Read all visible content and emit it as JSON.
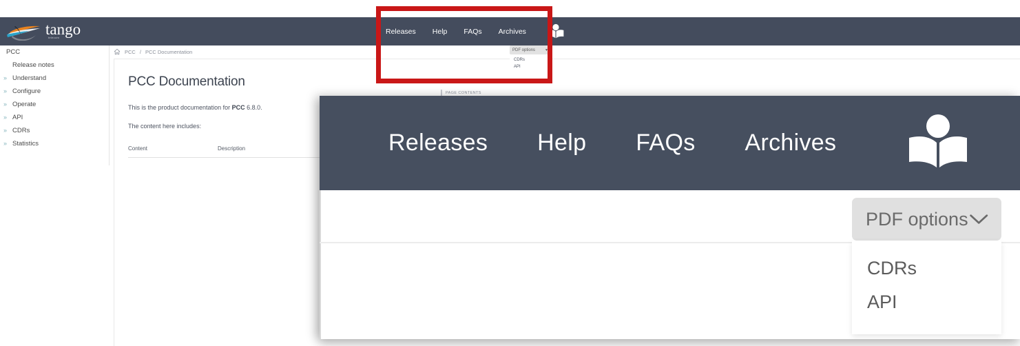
{
  "site": {
    "logo_text": "tango",
    "logo_subtext": "telecom",
    "nav": [
      {
        "label": "Releases",
        "name": "releases"
      },
      {
        "label": "Help",
        "name": "help"
      },
      {
        "label": "FAQs",
        "name": "faqs"
      },
      {
        "label": "Archives",
        "name": "archives"
      }
    ],
    "book_icon": "open-book-reader-icon",
    "header_color": "#444c5d"
  },
  "sidebar": {
    "items": [
      {
        "label": "PCC",
        "expandable": false,
        "indent": "root"
      },
      {
        "label": "Release notes",
        "expandable": false,
        "indent": "sub"
      },
      {
        "label": "Understand",
        "expandable": true,
        "indent": "exp"
      },
      {
        "label": "Configure",
        "expandable": true,
        "indent": "exp"
      },
      {
        "label": "Operate",
        "expandable": true,
        "indent": "exp"
      },
      {
        "label": "API",
        "expandable": true,
        "indent": "exp"
      },
      {
        "label": "CDRs",
        "expandable": true,
        "indent": "exp"
      },
      {
        "label": "Statistics",
        "expandable": true,
        "indent": "exp"
      }
    ],
    "chevron_icon": "double-chevron-right-icon",
    "chevron_glyph": "»",
    "chevron_color": "#86b5bd"
  },
  "breadcrumb": {
    "home_icon": "home-icon",
    "parent": "PCC",
    "separator": "/",
    "current": "PCC Documentation"
  },
  "content": {
    "title": "PCC Documentation",
    "paragraph1_pre": "This is the product documentation for ",
    "paragraph1_strong": "PCC",
    "paragraph1_post": " 6.8.0.",
    "paragraph2": "The content here includes:",
    "table_headers": [
      "Content",
      "Description"
    ]
  },
  "page_contents_panel": {
    "label": "PAGE CONTENTS"
  },
  "pdf_dropdown": {
    "button_label": "PDF options",
    "chevron_icon": "chevron-down-icon",
    "items": [
      {
        "label": "CDRs"
      },
      {
        "label": "API"
      }
    ],
    "button_bg": "#e0e0e0"
  },
  "highlight": {
    "name": "red-highlight-box",
    "color": "#c91717"
  }
}
